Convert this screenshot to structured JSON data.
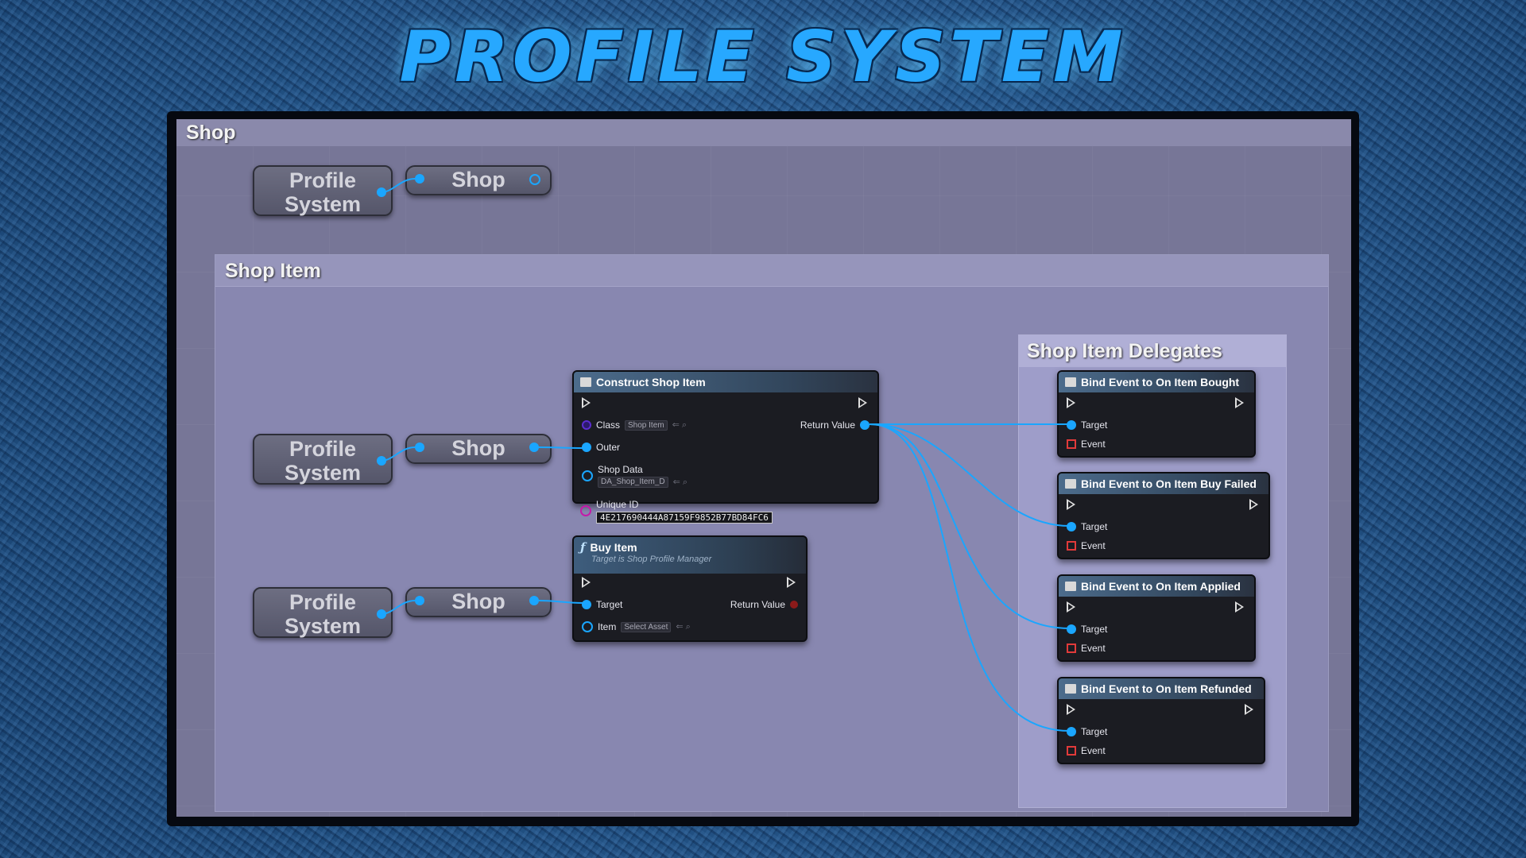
{
  "title": "PROFILE SYSTEM",
  "comments": {
    "shop": "Shop",
    "shop_item": "Shop Item",
    "delegates": "Shop Item Delegates"
  },
  "pills": {
    "profile_system": "Profile System",
    "shop": "Shop"
  },
  "construct_node": {
    "title": "Construct Shop Item",
    "class_label": "Class",
    "class_value": "Shop Item",
    "outer_label": "Outer",
    "shop_data_label": "Shop Data",
    "shop_data_value": "DA_Shop_Item_D",
    "unique_id_label": "Unique ID",
    "unique_id_value": "4E217690444A87159F9852B77BD84FC6",
    "return_label": "Return Value"
  },
  "buy_node": {
    "title": "Buy Item",
    "subtitle": "Target is Shop Profile Manager",
    "target_label": "Target",
    "return_label": "Return Value",
    "item_label": "Item",
    "item_value": "Select Asset"
  },
  "bind_nodes": [
    {
      "title": "Bind Event to On Item Bought",
      "target": "Target",
      "event": "Event"
    },
    {
      "title": "Bind Event to On Item Buy Failed",
      "target": "Target",
      "event": "Event"
    },
    {
      "title": "Bind Event to On Item Applied",
      "target": "Target",
      "event": "Event"
    },
    {
      "title": "Bind Event to On Item Refunded",
      "target": "Target",
      "event": "Event"
    }
  ],
  "colors": {
    "object_pin": "#1aa6ff",
    "class_pin": "#5a2ccf",
    "string_pin": "#c41aa8",
    "event_pin": "#e23a3a"
  }
}
